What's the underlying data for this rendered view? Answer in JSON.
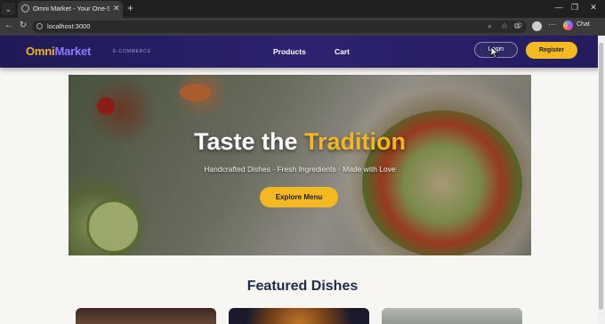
{
  "browser": {
    "tab_title": "Omni Market - Your One-Stop Sh",
    "url": "localhost:3000",
    "chat_label": "Chat"
  },
  "site": {
    "logo_part1": "Omni",
    "logo_part2": "Market",
    "logo_tagline": "E-COMMERCE",
    "nav": {
      "products": "Products",
      "cart": "Cart"
    },
    "login_label": "Login",
    "register_label": "Register"
  },
  "hero": {
    "title_main": "Taste the ",
    "title_highlight": "Tradition",
    "subtitle": "Handcrafted Dishes · Fresh Ingredients · Made with Love",
    "button_label": "Explore Menu"
  },
  "featured": {
    "title": "Featured Dishes"
  },
  "colors": {
    "header_bg": "#2c2270",
    "accent_gold": "#f4b820",
    "logo_purple": "#8b7bff",
    "heading_navy": "#1f2b4a"
  }
}
